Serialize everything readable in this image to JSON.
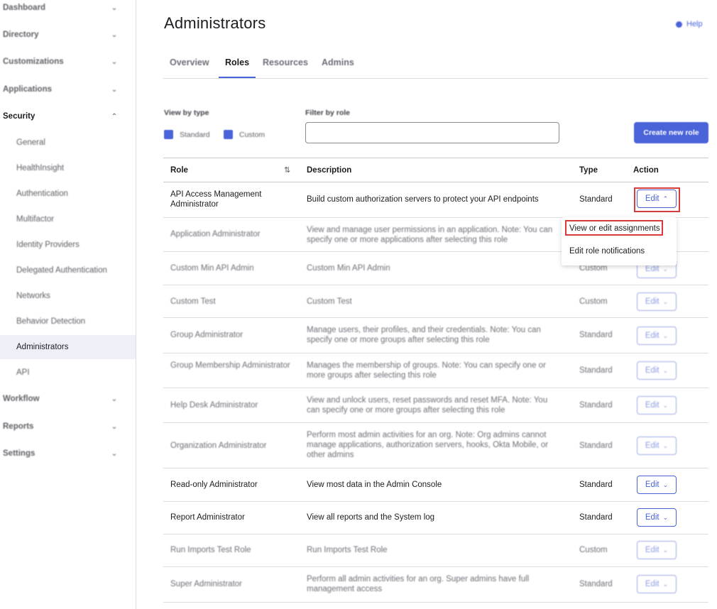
{
  "sidebar": {
    "sections": [
      {
        "label": "Dashboard",
        "chevron": "down"
      },
      {
        "label": "Directory",
        "chevron": "down"
      },
      {
        "label": "Customizations",
        "chevron": "down"
      },
      {
        "label": "Applications",
        "chevron": "down"
      },
      {
        "label": "Security",
        "chevron": "up"
      },
      {
        "label": "Workflow",
        "chevron": "down"
      },
      {
        "label": "Reports",
        "chevron": "down"
      },
      {
        "label": "Settings",
        "chevron": "down"
      }
    ],
    "security_items": [
      "General",
      "HealthInsight",
      "Authentication",
      "Multifactor",
      "Identity Providers",
      "Delegated Authentication",
      "Networks",
      "Behavior Detection",
      "Administrators",
      "API"
    ],
    "active_item": "Administrators"
  },
  "header": {
    "title": "Administrators",
    "help_label": "Help"
  },
  "tabs": [
    {
      "label": "Overview",
      "active": false
    },
    {
      "label": "Roles",
      "active": true
    },
    {
      "label": "Resources",
      "active": false
    },
    {
      "label": "Admins",
      "active": false
    }
  ],
  "filters": {
    "view_by_type_label": "View by type",
    "standard_label": "Standard",
    "custom_label": "Custom",
    "standard_checked": true,
    "custom_checked": true,
    "filter_by_role_label": "Filter by role",
    "filter_value": "",
    "create_button_label": "Create new role"
  },
  "table": {
    "columns": [
      "Role",
      "Description",
      "Type",
      "Action"
    ],
    "edit_label": "Edit",
    "rows": [
      {
        "role": "API Access Management Administrator",
        "description": "Build custom authorization servers to protect your API endpoints",
        "type": "Standard"
      },
      {
        "role": "Application Administrator",
        "description": "View and manage user permissions in an application. Note: You can specify one or more applications after selecting this role",
        "type": "Standard"
      },
      {
        "role": "Custom Min API Admin",
        "description": "Custom Min API Admin",
        "type": "Custom"
      },
      {
        "role": "Custom Test",
        "description": "Custom Test",
        "type": "Custom"
      },
      {
        "role": "Group Administrator",
        "description": "Manage users, their profiles, and their credentials. Note: You can specify one or more groups after selecting this role",
        "type": "Standard"
      },
      {
        "role": "Group Membership Administrator",
        "description": "Manages the membership of groups. Note: You can specify one or more groups after selecting this role",
        "type": "Standard"
      },
      {
        "role": "Help Desk Administrator",
        "description": "View and unlock users, reset passwords and reset MFA. Note: You can specify one or more groups after selecting this role",
        "type": "Standard"
      },
      {
        "role": "Organization Administrator",
        "description": "Perform most admin activities for an org. Note: Org admins cannot manage applications, authorization servers, hooks, Okta Mobile, or other admins",
        "type": "Standard"
      },
      {
        "role": "Read-only Administrator",
        "description": "View most data in the Admin Console",
        "type": "Standard"
      },
      {
        "role": "Report Administrator",
        "description": "View all reports and the System log",
        "type": "Standard"
      },
      {
        "role": "Run Imports Test Role",
        "description": "Run Imports Test Role",
        "type": "Custom"
      },
      {
        "role": "Super Administrator",
        "description": "Perform all admin activities for an org. Super admins have full management access",
        "type": "Standard"
      }
    ]
  },
  "dropdown": {
    "items": [
      "View or edit assignments",
      "Edit role notifications"
    ]
  },
  "colors": {
    "accent": "#4a63d8",
    "highlight": "#d63c3c"
  }
}
